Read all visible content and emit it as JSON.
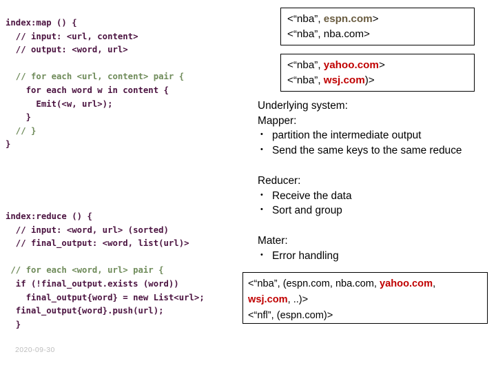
{
  "map_code": {
    "lines": [
      {
        "segments": [
          {
            "text": "index:map () {",
            "style": "key"
          }
        ]
      },
      {
        "segments": [
          {
            "text": "  // input: <url, content>",
            "style": "key"
          }
        ]
      },
      {
        "segments": [
          {
            "text": "  // output: <word, url>",
            "style": "key"
          }
        ]
      },
      {
        "segments": [
          {
            "text": " ",
            "style": "blank"
          }
        ]
      },
      {
        "segments": [
          {
            "text": "  // for each <url, content> pair {",
            "style": "cmt"
          }
        ]
      },
      {
        "segments": [
          {
            "text": "    for each word w in content {",
            "style": "key"
          }
        ]
      },
      {
        "segments": [
          {
            "text": "      Emit(<w, url>);",
            "style": "key"
          }
        ]
      },
      {
        "segments": [
          {
            "text": "    }",
            "style": "key"
          }
        ]
      },
      {
        "segments": [
          {
            "text": "  // }",
            "style": "cmt"
          }
        ]
      },
      {
        "segments": [
          {
            "text": "}",
            "style": "key"
          }
        ]
      }
    ]
  },
  "reduce_code": {
    "lines": [
      {
        "segments": [
          {
            "text": "index:reduce () {",
            "style": "key"
          }
        ]
      },
      {
        "segments": [
          {
            "text": "  // input: <word, url> (sorted)",
            "style": "key"
          }
        ]
      },
      {
        "segments": [
          {
            "text": "  // final_output: <word, list(url)>",
            "style": "key"
          }
        ]
      },
      {
        "segments": [
          {
            "text": " ",
            "style": "blank"
          }
        ]
      },
      {
        "segments": [
          {
            "text": " // for each <word, url> pair {",
            "style": "cmt"
          }
        ]
      },
      {
        "segments": [
          {
            "text": "  if (!final_output.exists (word))",
            "style": "key"
          }
        ]
      },
      {
        "segments": [
          {
            "text": "    final_output{word} = new List<url>;",
            "style": "key"
          }
        ]
      },
      {
        "segments": [
          {
            "text": "  final_output{word}.push(url);",
            "style": "key"
          }
        ]
      },
      {
        "segments": [
          {
            "text": "  }",
            "style": "key"
          }
        ]
      }
    ]
  },
  "box_1": {
    "lines": [
      {
        "segments": [
          {
            "text": "<“nba”, ",
            "style": "dark"
          },
          {
            "text": "espn.com",
            "style": "brown"
          },
          {
            "text": ">",
            "style": "dark"
          }
        ]
      },
      {
        "segments": [
          {
            "text": "<“nba”, nba.com>",
            "style": "dark"
          }
        ]
      }
    ]
  },
  "box_2": {
    "lines": [
      {
        "segments": [
          {
            "text": "<“nba”, ",
            "style": "dark"
          },
          {
            "text": "yahoo.com",
            "style": "red"
          },
          {
            "text": ">",
            "style": "dark"
          }
        ]
      },
      {
        "segments": [
          {
            "text": "<“nba”, ",
            "style": "dark"
          },
          {
            "text": "wsj.com",
            "style": "red"
          },
          {
            "text": ")>",
            "style": "dark"
          }
        ]
      }
    ]
  },
  "box_3": {
    "lines": [
      {
        "segments": [
          {
            "text": "<“nba”, (espn.com, nba.com, ",
            "style": "dark"
          },
          {
            "text": "yahoo.com",
            "style": "red"
          },
          {
            "text": ",",
            "style": "dark"
          }
        ]
      },
      {
        "segments": [
          {
            "text": "wsj.com",
            "style": "red"
          },
          {
            "text": ", ..)>",
            "style": "dark"
          }
        ]
      },
      {
        "segments": [
          {
            "text": "<“nfl”, (espn.com)>",
            "style": "dark"
          }
        ]
      }
    ]
  },
  "system_block": {
    "heading": "Underlying system:",
    "subheading": "Mapper:",
    "bullets": [
      "partition the intermediate output",
      "Send the same keys to the same reduce"
    ]
  },
  "reducer_block": {
    "heading": "Reducer:",
    "bullets": [
      "Receive the data",
      "Sort and group"
    ]
  },
  "master_block": {
    "heading": "Mater:",
    "bullets": [
      "Error handling"
    ]
  },
  "footer": {
    "date": "2020-09-30"
  },
  "colors": {
    "code_keyword": "#4b1340",
    "code_comment": "#6f8b5a",
    "highlight_red": "#c00000",
    "highlight_brown": "#6a5c40",
    "box_border": "#000000",
    "footer_text": "#bdbdbd"
  }
}
